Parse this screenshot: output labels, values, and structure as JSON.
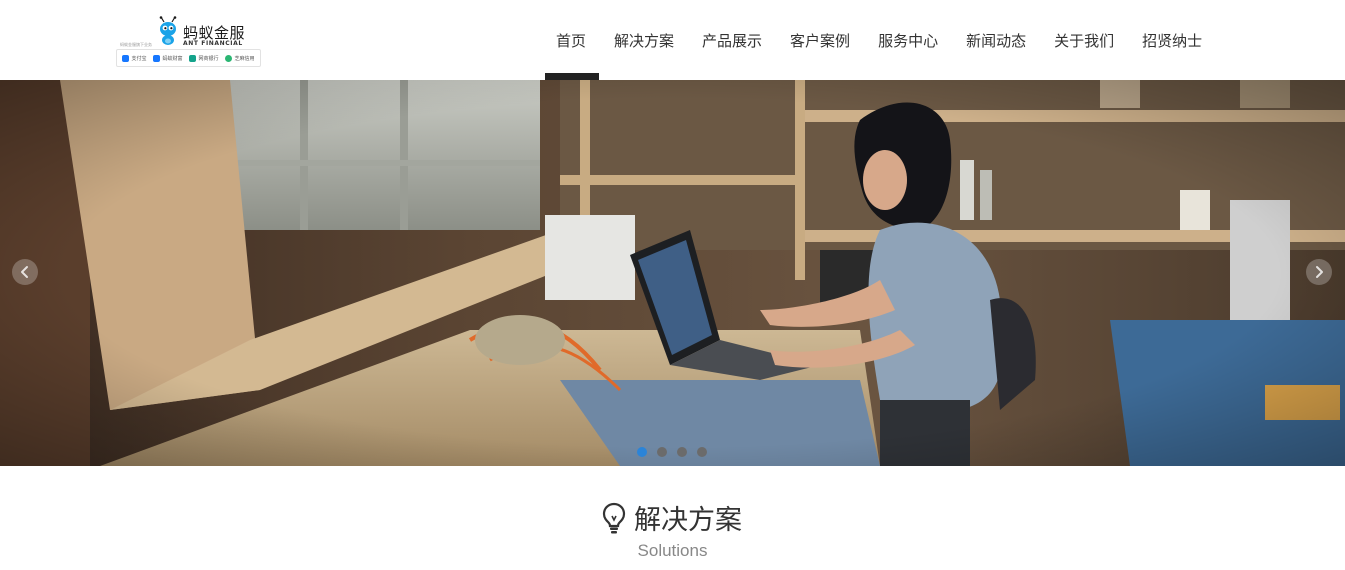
{
  "logo": {
    "name_cn": "蚂蚁金服",
    "name_en": "ANT FINANCIAL",
    "tagline": "蚂蚁金服旗下业务",
    "brands": [
      {
        "label": "支付宝",
        "color": "#1677ff"
      },
      {
        "label": "蚂蚁财富",
        "color": "#1677ff"
      },
      {
        "label": "网商银行",
        "color": "#14a38b"
      },
      {
        "label": "芝麻信用",
        "color": "#2bb673"
      }
    ]
  },
  "nav": {
    "items": [
      {
        "label": "首页",
        "active": true
      },
      {
        "label": "解决方案"
      },
      {
        "label": "产品展示"
      },
      {
        "label": "客户案例"
      },
      {
        "label": "服务中心"
      },
      {
        "label": "新闻动态"
      },
      {
        "label": "关于我们"
      },
      {
        "label": "招贤纳士"
      }
    ]
  },
  "banner": {
    "slide_count": 4,
    "active_slide": 1,
    "accent_color": "#2b84d8"
  },
  "section": {
    "icon": "lightbulb-icon",
    "title": "解决方案",
    "subtitle": "Solutions"
  }
}
